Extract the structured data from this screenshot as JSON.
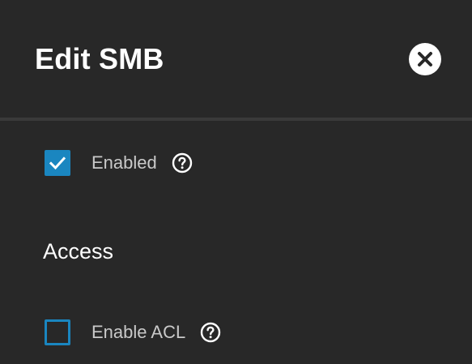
{
  "dialog": {
    "title": "Edit SMB",
    "close_icon": "close-icon"
  },
  "fields": {
    "enabled": {
      "label": "Enabled",
      "checked": true,
      "help_icon": "help-circle-icon"
    },
    "enable_acl": {
      "label": "Enable ACL",
      "checked": false,
      "help_icon": "help-circle-icon"
    }
  },
  "sections": {
    "access": {
      "heading": "Access"
    }
  },
  "colors": {
    "background": "#282828",
    "divider": "#3a3a3a",
    "accent": "#1a86c0",
    "label_text": "#c9c9c9",
    "title_text": "#ffffff"
  }
}
